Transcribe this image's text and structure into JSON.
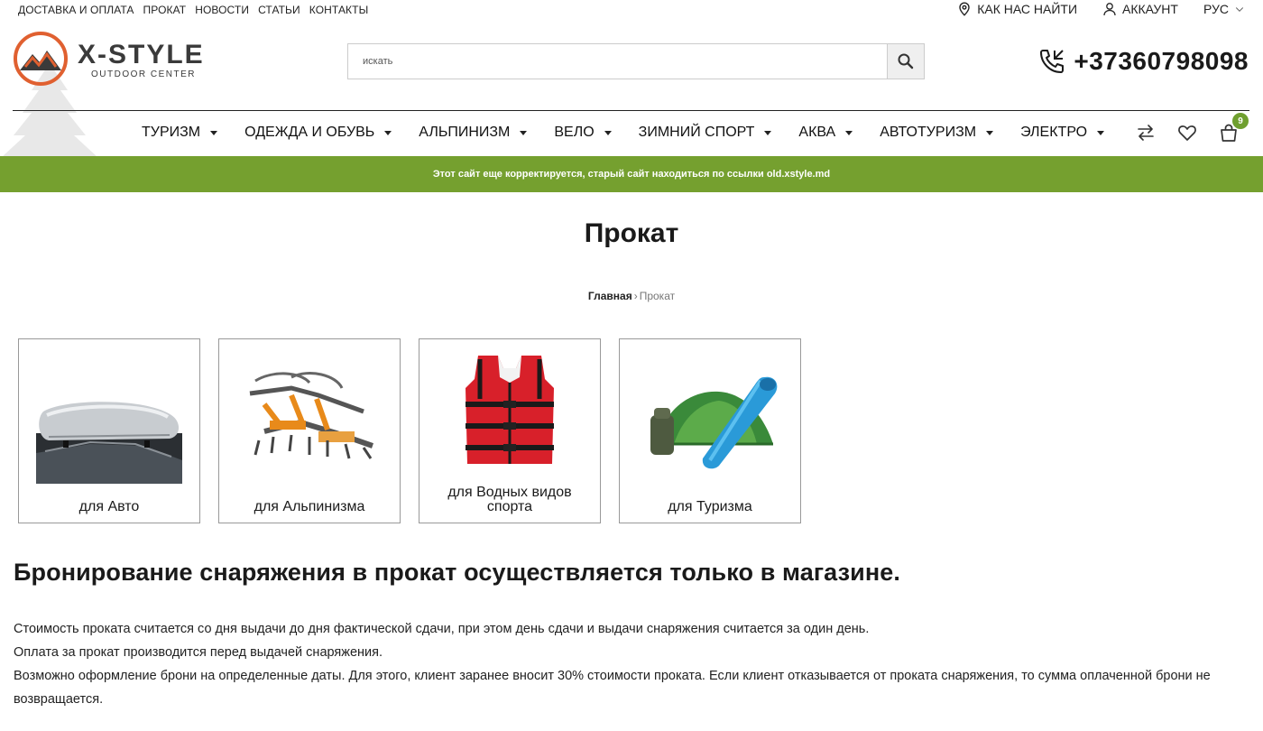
{
  "topbar": {
    "links": [
      "ДОСТАВКА И ОПЛАТА",
      "ПРОКАТ",
      "НОВОСТИ",
      "СТАТЬИ",
      "КОНТАКТЫ"
    ],
    "find_us": "КАК НАС НАЙТИ",
    "account": "АККАУНТ",
    "language": "РУС"
  },
  "logo": {
    "main": "X-STYLE",
    "sub": "OUTDOOR CENTER"
  },
  "search": {
    "placeholder": "искать"
  },
  "phone": "+37360798098",
  "nav": [
    "ТУРИЗМ",
    "ОДЕЖДА И ОБУВЬ",
    "АЛЬПИНИЗМ",
    "ВЕЛО",
    "ЗИМНИЙ СПОРТ",
    "АКВА",
    "АВТОТУРИЗМ",
    "ЭЛЕКТРО"
  ],
  "cart_count": "9",
  "notice": "Этот сайт еще корректируется, старый сайт находиться по ссылки old.xstyle.md",
  "page_title": "Прокат",
  "breadcrumb": {
    "home": "Главная",
    "current": "Прокат"
  },
  "cards": [
    {
      "label": "для Авто",
      "icon": "roof-box-icon"
    },
    {
      "label": "для Альпинизма",
      "icon": "crampons-icon"
    },
    {
      "label": "для Водных видов спорта",
      "icon": "life-vest-icon"
    },
    {
      "label": "для Туризма",
      "icon": "tent-sleeping-bag-icon"
    }
  ],
  "heading": "Бронирование снаряжения в прокат осуществляется только в магазине.",
  "paragraphs": [
    "Стоимость проката считается со дня выдачи до дня фактической сдачи, при этом день сдачи и выдачи снаряжения считается за один день.",
    "Оплата за прокат производится перед выдачей снаряжения.",
    "Возможно оформление брони на определенные даты. Для этого, клиент заранее вносит 30% стоимости проката. Если клиент отказывается от проката снаряжения, то сумма оплаченной брони не возвращается."
  ],
  "colors": {
    "accent_green": "#75a02f",
    "logo_orange": "#e06030"
  }
}
